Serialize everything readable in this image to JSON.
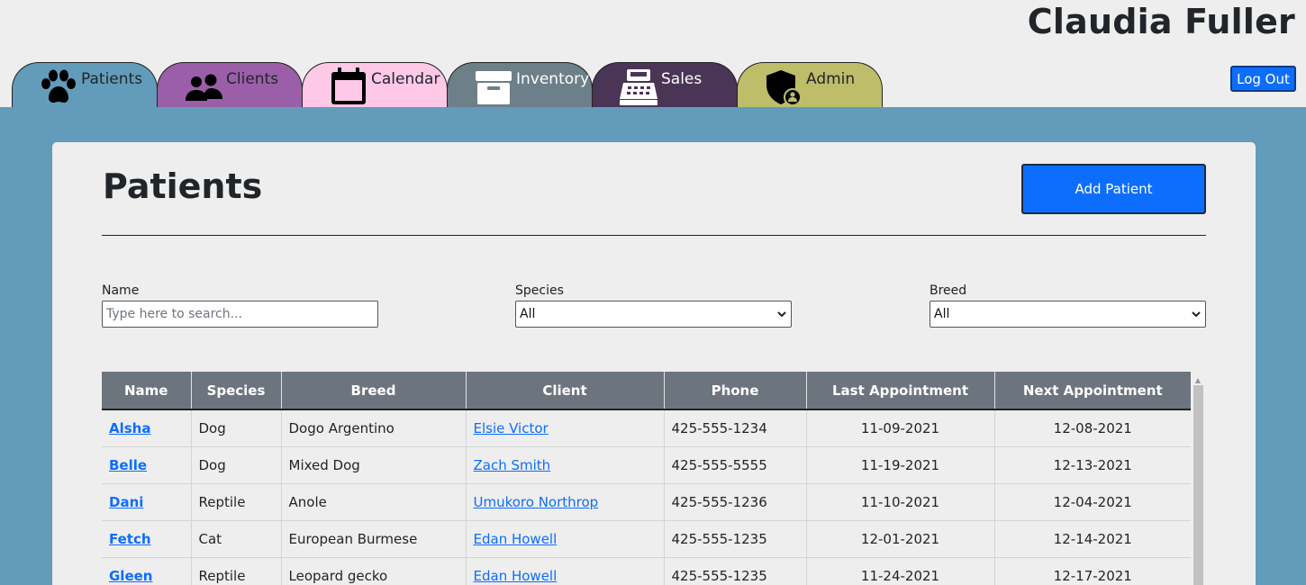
{
  "header": {
    "user_name": "Claudia Fuller",
    "logout_label": "Log Out"
  },
  "tabs": [
    {
      "label": "Patients",
      "icon": "paw-icon",
      "color": "#639cba"
    },
    {
      "label": "Clients",
      "icon": "people-icon",
      "color": "#9a5fa8"
    },
    {
      "label": "Calendar",
      "icon": "calendar-icon",
      "color": "#ffc8e6"
    },
    {
      "label": "Inventory",
      "icon": "archive-box-icon",
      "color": "#6d7f89"
    },
    {
      "label": "Sales",
      "icon": "cash-register-icon",
      "color": "#4b3556"
    },
    {
      "label": "Admin",
      "icon": "shield-user-icon",
      "color": "#bdbd6a"
    }
  ],
  "page": {
    "title": "Patients",
    "add_button_label": "Add Patient"
  },
  "filters": {
    "name": {
      "label": "Name",
      "placeholder": "Type here to search..."
    },
    "species": {
      "label": "Species",
      "value": "All"
    },
    "breed": {
      "label": "Breed",
      "value": "All"
    }
  },
  "table": {
    "headers": [
      "Name",
      "Species",
      "Breed",
      "Client",
      "Phone",
      "Last Appointment",
      "Next Appointment"
    ],
    "rows": [
      [
        "Alsha",
        "Dog",
        "Dogo Argentino",
        "Elsie Victor",
        "425-555-1234",
        "11-09-2021",
        "12-08-2021"
      ],
      [
        "Belle",
        "Dog",
        "Mixed Dog",
        "Zach Smith",
        "425-555-5555",
        "11-19-2021",
        "12-13-2021"
      ],
      [
        "Dani",
        "Reptile",
        "Anole",
        "Umukoro Northrop",
        "425-555-1236",
        "11-10-2021",
        "12-04-2021"
      ],
      [
        "Fetch",
        "Cat",
        "European Burmese",
        "Edan Howell",
        "425-555-1235",
        "12-01-2021",
        "12-14-2021"
      ],
      [
        "Gleen",
        "Reptile",
        "Leopard gecko",
        "Edan Howell",
        "425-555-1235",
        "11-24-2021",
        "12-17-2021"
      ]
    ]
  },
  "colors": {
    "accent": "#0d6efd",
    "main_bg": "#639cba",
    "table_header": "#6c757d"
  }
}
